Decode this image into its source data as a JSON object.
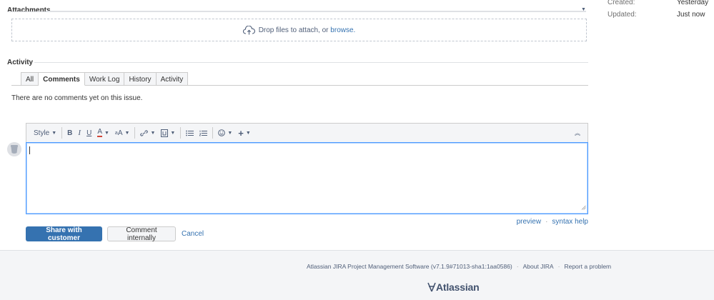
{
  "attachments": {
    "title": "Attachments",
    "drop_text": "Drop files to attach, or",
    "browse_link": "browse."
  },
  "details": {
    "created_label": "Created:",
    "created_value": "Yesterday",
    "updated_label": "Updated:",
    "updated_value": "Just now"
  },
  "activity": {
    "title": "Activity",
    "tabs": [
      {
        "label": "All"
      },
      {
        "label": "Comments"
      },
      {
        "label": "Work Log"
      },
      {
        "label": "History"
      },
      {
        "label": "Activity"
      }
    ],
    "active_tab": "Comments",
    "empty_text": "There are no comments yet on this issue."
  },
  "editor": {
    "style_label": "Style",
    "value": "",
    "links": {
      "preview": "preview",
      "syntax_help": "syntax help"
    }
  },
  "actions": {
    "share": "Share with customer",
    "internal": "Comment internally",
    "cancel": "Cancel"
  },
  "footer": {
    "software": "Atlassian JIRA Project Management Software (v7.1.9#71013-sha1:1aa0586)",
    "about": "About JIRA",
    "report": "Report a problem",
    "logo_text": "Atlassian"
  },
  "colors": {
    "primary": "#3572b0",
    "link": "#3572b0",
    "footer_bg": "#f4f5f7",
    "editor_focus": "#4c9aff"
  },
  "icons": [
    "cloud-upload-icon",
    "collapse-icon",
    "bold-icon",
    "italic-icon",
    "underline-icon",
    "text-color-icon",
    "text-size-icon",
    "link-icon",
    "attachment-icon",
    "bullet-list-icon",
    "numbered-list-icon",
    "emoticon-icon",
    "insert-more-icon",
    "resize-grip-icon",
    "atlassian-logo-icon"
  ]
}
